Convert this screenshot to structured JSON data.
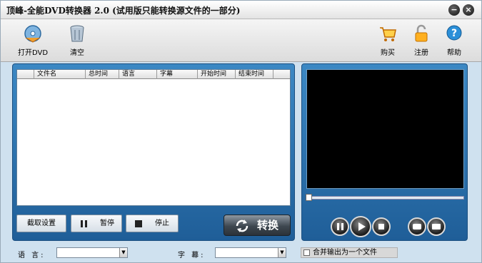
{
  "window": {
    "title": "顶峰-全能DVD转换器 2.0 (试用版只能转换源文件的一部分)"
  },
  "toolbar": {
    "open_dvd": {
      "label": "打开DVD",
      "icon": "dvd-disc-icon"
    },
    "clear": {
      "label": "清空",
      "icon": "trash-bin-icon"
    },
    "buy": {
      "label": "购买",
      "icon": "shopping-cart-icon"
    },
    "register": {
      "label": "注册",
      "icon": "lock-icon"
    },
    "help": {
      "label": "帮助",
      "icon": "help-icon"
    }
  },
  "file_list": {
    "columns": [
      "文件名",
      "总时间",
      "语言",
      "字幕",
      "开始时间",
      "结束时间"
    ],
    "rows": []
  },
  "actions": {
    "capture_settings": "截取设置",
    "pause": "暂停",
    "stop": "停止",
    "convert": "转换"
  },
  "player": {
    "seek_progress": 0
  },
  "options": {
    "language_label": "语    言:",
    "language_value": "",
    "subtitle_label": "字    幕:",
    "subtitle_value": "",
    "merge_label": "合并输出为一个文件",
    "merge_checked": false
  },
  "colors": {
    "panel_blue": "#2a73b0",
    "video_bg": "#000000",
    "convert_dark": "#3e4750"
  }
}
